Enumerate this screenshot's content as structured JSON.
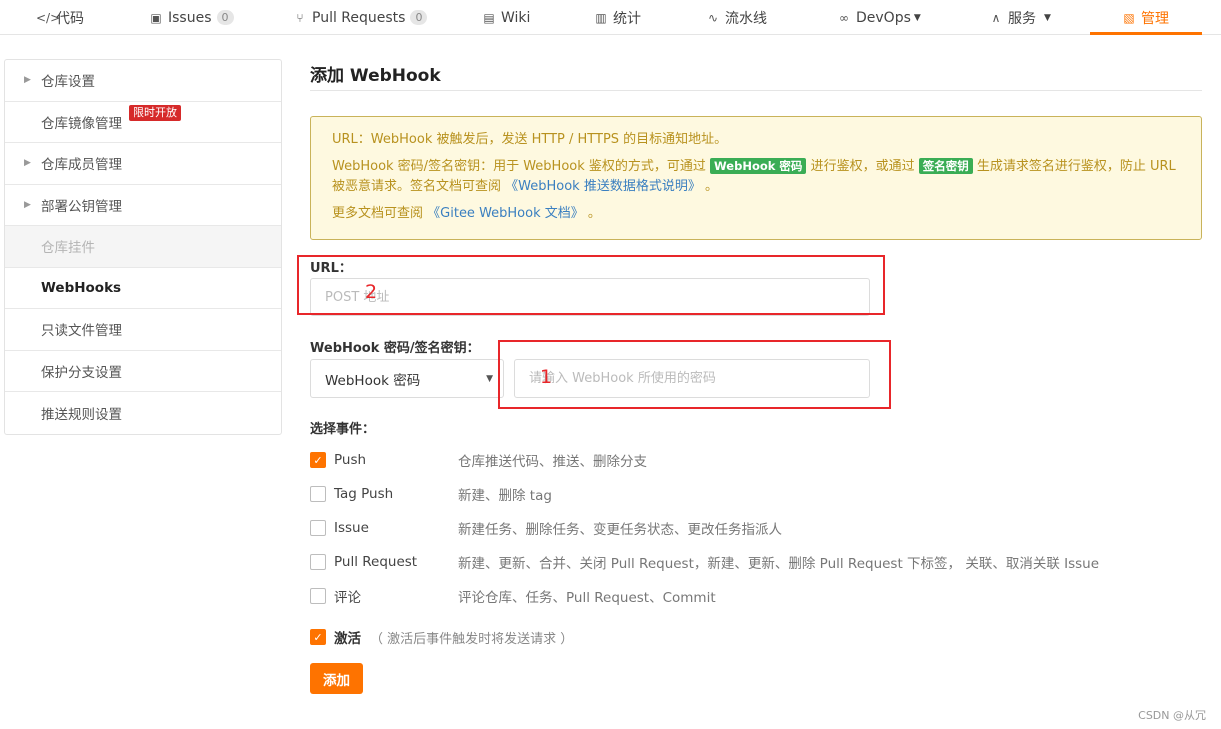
{
  "nav": {
    "tabs": [
      {
        "label": "代码",
        "icon": "</>"
      },
      {
        "label": "Issues",
        "count": "0",
        "icon": "▣"
      },
      {
        "label": "Pull Requests",
        "count": "0",
        "icon": "⑂"
      },
      {
        "label": "Wiki",
        "icon": "▤"
      },
      {
        "label": "统计",
        "icon": "▥"
      },
      {
        "label": "流水线",
        "icon": "∿"
      },
      {
        "label": "DevOps",
        "icon": "∞"
      },
      {
        "label": "服务",
        "icon": "∧"
      },
      {
        "label": "管理",
        "icon": "▧"
      }
    ],
    "accent_color": "#fe7300"
  },
  "sidebar": {
    "items": [
      {
        "label": "仓库设置"
      },
      {
        "label": "仓库镜像管理",
        "badge": "限时开放"
      },
      {
        "label": "仓库成员管理"
      },
      {
        "label": "部署公钥管理"
      },
      {
        "label": "仓库挂件"
      },
      {
        "label": "WebHooks"
      },
      {
        "label": "只读文件管理"
      },
      {
        "label": "保护分支设置"
      },
      {
        "label": "推送规则设置"
      }
    ]
  },
  "main": {
    "title": "添加 WebHook",
    "notice": {
      "line1": "URL：WebHook 被触发后，发送 HTTP / HTTPS 的目标通知地址。",
      "line2_a": "WebHook 密码/签名密钥：用于 WebHook 鉴权的方式，可通过",
      "line2_tag1": "WebHook 密码",
      "line2_b": "进行鉴权，或通过",
      "line2_tag2": "签名密钥",
      "line2_c": "生成请求签名进行鉴权，防止 URL 被恶意请求。签名文档可查阅",
      "line2_link": "《WebHook 推送数据格式说明》",
      "line2_d": "。",
      "line3_a": "更多文档可查阅",
      "line3_link": "《Gitee WebHook 文档》",
      "line3_b": "。"
    },
    "url_label": "URL：",
    "url_placeholder": "POST 地址",
    "secret_label": "WebHook 密码/签名密钥：",
    "secret_select": "WebHook 密码",
    "secret_placeholder": "请输入 WebHook 所使用的密码",
    "annotation_1": "1",
    "annotation_2": "2",
    "events_label": "选择事件：",
    "events": [
      {
        "name": "Push",
        "desc": "仓库推送代码、推送、删除分支",
        "checked": true
      },
      {
        "name": "Tag Push",
        "desc": "新建、删除 tag",
        "checked": false
      },
      {
        "name": "Issue",
        "desc": "新建任务、删除任务、变更任务状态、更改任务指派人",
        "checked": false
      },
      {
        "name": "Pull Request",
        "desc": "新建、更新、合并、关闭 Pull Request，新建、更新、删除 Pull Request 下标签， 关联、取消关联 Issue",
        "checked": false
      },
      {
        "name": "评论",
        "desc": "评论仓库、任务、Pull Request、Commit",
        "checked": false
      }
    ],
    "active_label": "激活",
    "active_hint": "（ 激活后事件触发时将发送请求 ）",
    "add_button": "添加"
  },
  "watermark": "CSDN @从冗"
}
